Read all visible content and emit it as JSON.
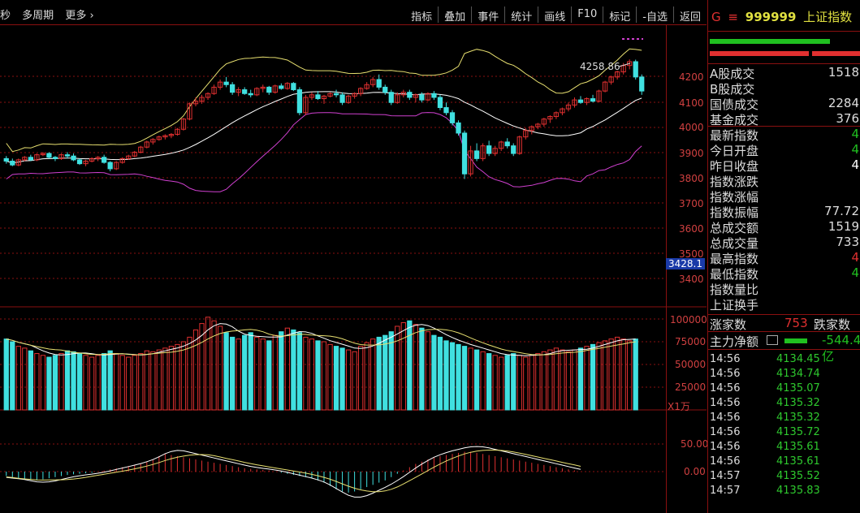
{
  "toolbar": {
    "left": [
      "秒",
      "多周期",
      "更多 ›"
    ],
    "buttons": [
      "指标",
      "叠加",
      "事件",
      "统计",
      "画线",
      "F10",
      "标记",
      "-自选",
      "返回"
    ]
  },
  "main_chart": {
    "y_labels": [
      "4200",
      "4100",
      "4000",
      "3900",
      "3800",
      "3700",
      "3600",
      "3500",
      "3400"
    ],
    "high_annotation": "4258.86",
    "current_price_tag": "3428.1"
  },
  "volume_chart": {
    "y_labels": [
      "100000",
      "75000",
      "50000",
      "25000"
    ],
    "unit": "X1万"
  },
  "macd_chart": {
    "y_labels": [
      "50.00",
      "0.00"
    ]
  },
  "quote_panel": {
    "g_label": "G",
    "menu_icon": "≡",
    "code": "999999",
    "name": "上证指数",
    "rows": [
      {
        "label": "A股成交",
        "value": "1518"
      },
      {
        "label": "B股成交",
        "value": ""
      },
      {
        "label": "国债成交",
        "value": "2284"
      },
      {
        "label": "基金成交",
        "value": "376"
      },
      {
        "label": "最新指数",
        "value": "4"
      },
      {
        "label": "今日开盘",
        "value": "4"
      },
      {
        "label": "昨日收盘",
        "value": "4"
      },
      {
        "label": "指数涨跌",
        "value": ""
      },
      {
        "label": "指数涨幅",
        "value": ""
      },
      {
        "label": "指数振幅",
        "value": "77.72"
      },
      {
        "label": "总成交额",
        "value": "1519"
      },
      {
        "label": "总成交量",
        "value": "733"
      },
      {
        "label": "最高指数",
        "value": "4"
      },
      {
        "label": "最低指数",
        "value": "4"
      },
      {
        "label": "指数量比",
        "value": ""
      },
      {
        "label": "上证换手",
        "value": ""
      }
    ],
    "up_down": {
      "up_label": "涨家数",
      "up_value": "753",
      "down_label": "跌家数"
    },
    "main_flow": {
      "label": "主力净额",
      "value": "-544.4亿"
    },
    "ticks": [
      {
        "time": "14:56",
        "price": "4134.45"
      },
      {
        "time": "14:56",
        "price": "4134.74"
      },
      {
        "time": "14:56",
        "price": "4135.07"
      },
      {
        "time": "14:56",
        "price": "4135.32"
      },
      {
        "time": "14:56",
        "price": "4135.32"
      },
      {
        "time": "14:56",
        "price": "4135.72"
      },
      {
        "time": "14:56",
        "price": "4135.61"
      },
      {
        "time": "14:56",
        "price": "4135.61"
      },
      {
        "time": "14:57",
        "price": "4135.52"
      },
      {
        "time": "14:57",
        "price": "4135.83"
      }
    ]
  },
  "colors": {
    "up": "#e03030",
    "down": "#40e0e0",
    "grid": "#8a1010",
    "yellow": "#e8e070",
    "magenta": "#d040d0",
    "white": "#ffffff"
  },
  "chart_data": {
    "type": "candlestick",
    "y_range": [
      3400,
      4250
    ],
    "candles": [
      [
        3870,
        3880,
        3850,
        3860
      ],
      [
        3860,
        3870,
        3840,
        3845
      ],
      [
        3845,
        3870,
        3840,
        3865
      ],
      [
        3865,
        3880,
        3860,
        3875
      ],
      [
        3875,
        3885,
        3860,
        3865
      ],
      [
        3865,
        3890,
        3860,
        3885
      ],
      [
        3885,
        3895,
        3880,
        3890
      ],
      [
        3890,
        3895,
        3870,
        3875
      ],
      [
        3875,
        3880,
        3860,
        3870
      ],
      [
        3870,
        3890,
        3865,
        3885
      ],
      [
        3885,
        3895,
        3870,
        3880
      ],
      [
        3880,
        3890,
        3860,
        3865
      ],
      [
        3865,
        3870,
        3845,
        3850
      ],
      [
        3850,
        3865,
        3840,
        3860
      ],
      [
        3860,
        3875,
        3855,
        3870
      ],
      [
        3870,
        3880,
        3860,
        3875
      ],
      [
        3875,
        3885,
        3850,
        3855
      ],
      [
        3855,
        3860,
        3820,
        3830
      ],
      [
        3830,
        3860,
        3825,
        3855
      ],
      [
        3855,
        3875,
        3850,
        3870
      ],
      [
        3870,
        3885,
        3865,
        3880
      ],
      [
        3880,
        3900,
        3875,
        3895
      ],
      [
        3895,
        3920,
        3890,
        3915
      ],
      [
        3915,
        3940,
        3910,
        3935
      ],
      [
        3935,
        3950,
        3925,
        3945
      ],
      [
        3945,
        3960,
        3940,
        3955
      ],
      [
        3955,
        3965,
        3945,
        3960
      ],
      [
        3960,
        3970,
        3950,
        3965
      ],
      [
        3965,
        3990,
        3960,
        3985
      ],
      [
        3985,
        4030,
        3980,
        4025
      ],
      [
        4025,
        4090,
        4020,
        4085
      ],
      [
        4085,
        4110,
        4075,
        4095
      ],
      [
        4095,
        4120,
        4085,
        4110
      ],
      [
        4110,
        4130,
        4100,
        4125
      ],
      [
        4125,
        4160,
        4120,
        4150
      ],
      [
        4150,
        4180,
        4140,
        4170
      ],
      [
        4170,
        4190,
        4150,
        4160
      ],
      [
        4160,
        4170,
        4120,
        4130
      ],
      [
        4130,
        4150,
        4115,
        4140
      ],
      [
        4140,
        4150,
        4120,
        4125
      ],
      [
        4125,
        4140,
        4110,
        4120
      ],
      [
        4120,
        4150,
        4115,
        4145
      ],
      [
        4145,
        4160,
        4130,
        4150
      ],
      [
        4150,
        4155,
        4120,
        4130
      ],
      [
        4130,
        4160,
        4125,
        4155
      ],
      [
        4155,
        4165,
        4140,
        4145
      ],
      [
        4145,
        4170,
        4140,
        4165
      ],
      [
        4165,
        4170,
        4135,
        4140
      ],
      [
        4140,
        4150,
        4040,
        4050
      ],
      [
        4050,
        4120,
        4040,
        4110
      ],
      [
        4110,
        4130,
        4100,
        4120
      ],
      [
        4120,
        4135,
        4100,
        4105
      ],
      [
        4105,
        4120,
        4085,
        4115
      ],
      [
        4115,
        4130,
        4110,
        4125
      ],
      [
        4125,
        4140,
        4110,
        4120
      ],
      [
        4120,
        4130,
        4080,
        4090
      ],
      [
        4090,
        4120,
        4085,
        4115
      ],
      [
        4115,
        4130,
        4105,
        4125
      ],
      [
        4125,
        4150,
        4115,
        4145
      ],
      [
        4145,
        4170,
        4140,
        4160
      ],
      [
        4160,
        4190,
        4150,
        4180
      ],
      [
        4180,
        4200,
        4140,
        4150
      ],
      [
        4150,
        4160,
        4120,
        4130
      ],
      [
        4130,
        4140,
        4080,
        4090
      ],
      [
        4090,
        4130,
        4085,
        4120
      ],
      [
        4120,
        4140,
        4110,
        4130
      ],
      [
        4130,
        4140,
        4100,
        4110
      ],
      [
        4110,
        4125,
        4090,
        4120
      ],
      [
        4120,
        4130,
        4090,
        4100
      ],
      [
        4100,
        4130,
        4095,
        4125
      ],
      [
        4125,
        4135,
        4100,
        4110
      ],
      [
        4110,
        4120,
        4060,
        4070
      ],
      [
        4070,
        4090,
        4040,
        4050
      ],
      [
        4050,
        4060,
        4000,
        4010
      ],
      [
        4010,
        4020,
        3960,
        3970
      ],
      [
        3970,
        3980,
        3790,
        3810
      ],
      [
        3810,
        3920,
        3800,
        3900
      ],
      [
        3900,
        3930,
        3860,
        3870
      ],
      [
        3870,
        3930,
        3860,
        3920
      ],
      [
        3920,
        3940,
        3880,
        3890
      ],
      [
        3890,
        3920,
        3880,
        3910
      ],
      [
        3910,
        3940,
        3900,
        3935
      ],
      [
        3935,
        3950,
        3910,
        3920
      ],
      [
        3920,
        3930,
        3880,
        3890
      ],
      [
        3890,
        3960,
        3885,
        3955
      ],
      [
        3955,
        3990,
        3945,
        3980
      ],
      [
        3980,
        4000,
        3965,
        3995
      ],
      [
        3995,
        4010,
        3985,
        4005
      ],
      [
        4005,
        4030,
        3995,
        4025
      ],
      [
        4025,
        4040,
        4010,
        4035
      ],
      [
        4035,
        4055,
        4025,
        4050
      ],
      [
        4050,
        4070,
        4040,
        4065
      ],
      [
        4065,
        4090,
        4055,
        4080
      ],
      [
        4080,
        4110,
        4070,
        4100
      ],
      [
        4100,
        4115,
        4085,
        4090
      ],
      [
        4090,
        4110,
        4080,
        4105
      ],
      [
        4105,
        4120,
        4090,
        4095
      ],
      [
        4095,
        4140,
        4090,
        4135
      ],
      [
        4135,
        4175,
        4130,
        4170
      ],
      [
        4170,
        4195,
        4160,
        4190
      ],
      [
        4190,
        4215,
        4180,
        4210
      ],
      [
        4210,
        4245,
        4200,
        4235
      ],
      [
        4235,
        4258.86,
        4220,
        4250
      ],
      [
        4250,
        4258,
        4180,
        4190
      ],
      [
        4190,
        4200,
        4120,
        4135
      ]
    ],
    "volume": [
      78,
      75,
      70,
      68,
      65,
      62,
      60,
      58,
      60,
      62,
      65,
      64,
      62,
      60,
      58,
      60,
      62,
      65,
      62,
      60,
      58,
      60,
      62,
      65,
      64,
      66,
      68,
      70,
      72,
      75,
      80,
      88,
      95,
      102,
      98,
      92,
      85,
      80,
      78,
      82,
      85,
      80,
      78,
      76,
      82,
      86,
      90,
      88,
      85,
      80,
      78,
      76,
      75,
      72,
      70,
      68,
      66,
      64,
      70,
      74,
      78,
      80,
      82,
      86,
      92,
      96,
      98,
      94,
      90,
      86,
      82,
      80,
      76,
      74,
      72,
      70,
      68,
      66,
      64,
      62,
      60,
      58,
      60,
      62,
      60,
      58,
      60,
      62,
      64,
      66,
      68,
      66,
      64,
      66,
      68,
      70,
      72,
      74,
      76,
      78,
      80,
      78,
      76,
      78
    ],
    "macd_diff": [
      -8,
      -10,
      -12,
      -14,
      -15,
      -16,
      -14,
      -12,
      -10,
      -8,
      -6,
      -5,
      -4,
      -3,
      -2,
      0,
      2,
      4,
      6,
      8,
      10,
      12,
      15,
      18,
      22,
      28,
      32,
      30,
      28,
      26,
      24,
      22,
      20,
      18,
      16,
      14,
      12,
      10,
      8,
      6,
      5,
      4,
      3,
      2,
      0,
      -2,
      -4,
      -6,
      -8,
      -10,
      -12,
      -16,
      -20,
      -26,
      -32,
      -36,
      -38,
      -36,
      -32,
      -28,
      -24,
      -20,
      -16,
      -10,
      -4,
      2,
      8,
      14,
      18,
      22,
      26,
      28,
      30,
      32,
      34,
      36,
      36,
      34,
      32,
      30,
      28,
      26,
      24,
      22,
      20,
      18,
      16,
      14,
      12,
      10,
      8,
      6,
      4,
      2,
      0
    ]
  }
}
